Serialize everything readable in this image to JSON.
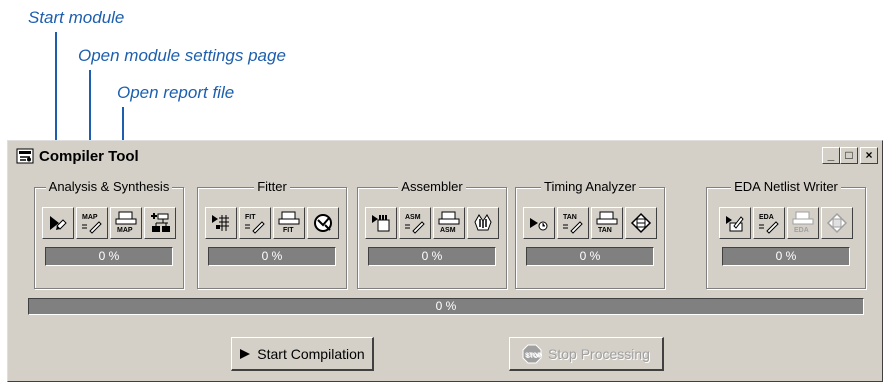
{
  "annotations": {
    "start_module": "Start module",
    "open_settings": "Open module settings page",
    "open_report": "Open report file"
  },
  "window": {
    "title": "Compiler Tool",
    "minimize_label": "_",
    "maximize_label": "□",
    "close_label": "×"
  },
  "modules": [
    {
      "name": "Analysis & Synthesis",
      "progress": "0 %",
      "tool_icons": [
        "start-module-icon",
        "map-settings-icon",
        "map-report-icon",
        "netlist-viewer-icon"
      ],
      "settings_tag": "MAP",
      "report_tag": "MAP"
    },
    {
      "name": "Fitter",
      "progress": "0 %",
      "tool_icons": [
        "start-module-icon",
        "fit-settings-icon",
        "fit-report-icon",
        "floorplan-icon"
      ],
      "settings_tag": "FIT",
      "report_tag": "FIT"
    },
    {
      "name": "Assembler",
      "progress": "0 %",
      "tool_icons": [
        "start-module-icon",
        "asm-settings-icon",
        "asm-report-icon",
        "programmer-icon"
      ],
      "settings_tag": "ASM",
      "report_tag": "ASM"
    },
    {
      "name": "Timing Analyzer",
      "progress": "0 %",
      "tool_icons": [
        "start-module-icon",
        "tan-settings-icon",
        "tan-report-icon",
        "timing-chip-icon"
      ],
      "settings_tag": "TAN",
      "report_tag": "TAN"
    },
    {
      "name": "EDA Netlist Writer",
      "progress": "0 %",
      "tool_icons": [
        "start-module-icon",
        "eda-settings-icon",
        "eda-report-icon",
        "eda-chip-icon"
      ],
      "settings_tag": "EDA",
      "report_tag": "EDA"
    }
  ],
  "overall_progress": "0 %",
  "buttons": {
    "start_compilation": "Start Compilation",
    "stop_processing": "Stop Processing",
    "stop_badge": "STOP"
  },
  "colors": {
    "annotation": "#1d5fae",
    "window_bg": "#d4d0c8",
    "progress_bg": "#808080"
  }
}
